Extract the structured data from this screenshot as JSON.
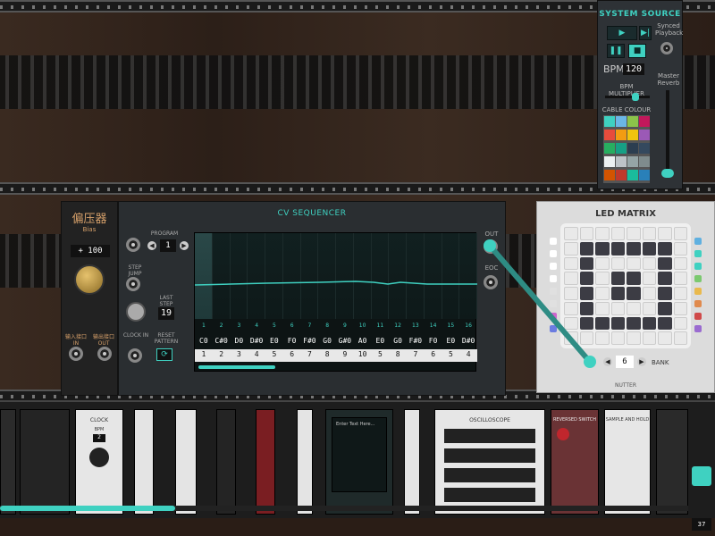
{
  "system_source": {
    "title": "SYSTEM SOURCE",
    "synced_label": "Synced Playback",
    "bpm_label": "BPM",
    "bpm_value": "120",
    "bpm_multiplier_label": "BPM MULTIPLIER",
    "cable_colour_label": "CABLE COLOUR",
    "master_reverb_label": "Master Reverb",
    "swatch_colors": [
      "#3fd1c1",
      "#6bb7e6",
      "#8bc34a",
      "#c2185b",
      "#e74c3c",
      "#f39c12",
      "#f1c40f",
      "#9b59b6",
      "#27ae60",
      "#16a085",
      "#2c3e50",
      "#34495e",
      "#ecf0f1",
      "#bdc3c7",
      "#95a5a6",
      "#7f8c8d",
      "#d35400",
      "#c0392b",
      "#1abc9c",
      "#2980b9"
    ]
  },
  "bias": {
    "title_cn": "偏压器",
    "title_en": "Bias",
    "display": "+ 100",
    "in_label": "输入接口\nIN",
    "out_label": "输出接口\nOUT"
  },
  "sequencer": {
    "title": "CV SEQUENCER",
    "program_label": "PROGRAM",
    "program_value": "1",
    "step_jump_label": "STEP JUMP",
    "last_step_label": "LAST STEP",
    "last_step_value": "19",
    "clock_in_label": "CLOCK IN",
    "reset_pattern_label": "RESET PATTERN",
    "out_label": "OUT",
    "eoc_label": "EOC",
    "steps": [
      "1",
      "2",
      "3",
      "4",
      "5",
      "6",
      "7",
      "8",
      "9",
      "10",
      "11",
      "12",
      "13",
      "14",
      "15",
      "16"
    ],
    "notes": [
      "C0",
      "C#0",
      "D0",
      "D#0",
      "E0",
      "F0",
      "F#0",
      "G0",
      "G#0",
      "A0",
      "E0",
      "G0",
      "F#0",
      "F0",
      "E0",
      "D#0"
    ],
    "bottom_values": [
      "1",
      "2",
      "3",
      "4",
      "5",
      "6",
      "7",
      "8",
      "9",
      "10",
      "5",
      "8",
      "7",
      "6",
      "5",
      "4"
    ]
  },
  "led_matrix": {
    "title": "LED MATRIX",
    "bank_label": "BANK",
    "bank_value": "6",
    "brand": "NUTTER"
  },
  "bottom_rack": {
    "page_counter": "37",
    "modules": [
      "CLOCK",
      "OSCILLOSCOPE",
      "REVERSED SWITCH",
      "SAMPLE AND HOLD"
    ],
    "clock_sub": "BPM",
    "clock_display": "2",
    "scope_text": "Enter Text Here..."
  }
}
